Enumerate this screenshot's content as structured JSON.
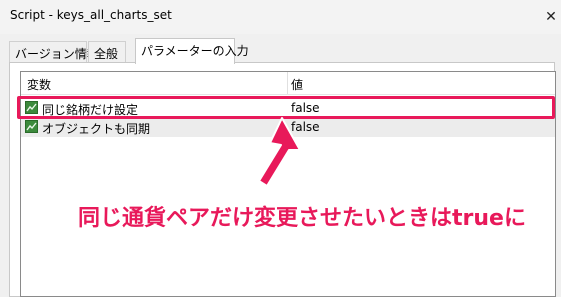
{
  "window": {
    "title": "Script - keys_all_charts_set"
  },
  "tabs": [
    {
      "label": "バージョン情報",
      "active": false
    },
    {
      "label": "全般",
      "active": false
    },
    {
      "label": "パラメーターの入力",
      "active": true
    }
  ],
  "table": {
    "columns": [
      "変数",
      "値"
    ],
    "rows": [
      {
        "name": "同じ銘柄だけ設定",
        "value": "false",
        "icon": "parameter-icon"
      },
      {
        "name": "オブジェクトも同期",
        "value": "false",
        "icon": "parameter-icon"
      }
    ]
  },
  "annotation": {
    "text": "同じ通貨ペアだけ変更させたいときはtrueに",
    "color": "#e8195a"
  },
  "colors": {
    "accent": "#e8195a",
    "icon_green": "#3c8a3c",
    "alt_row": "#ececec"
  }
}
